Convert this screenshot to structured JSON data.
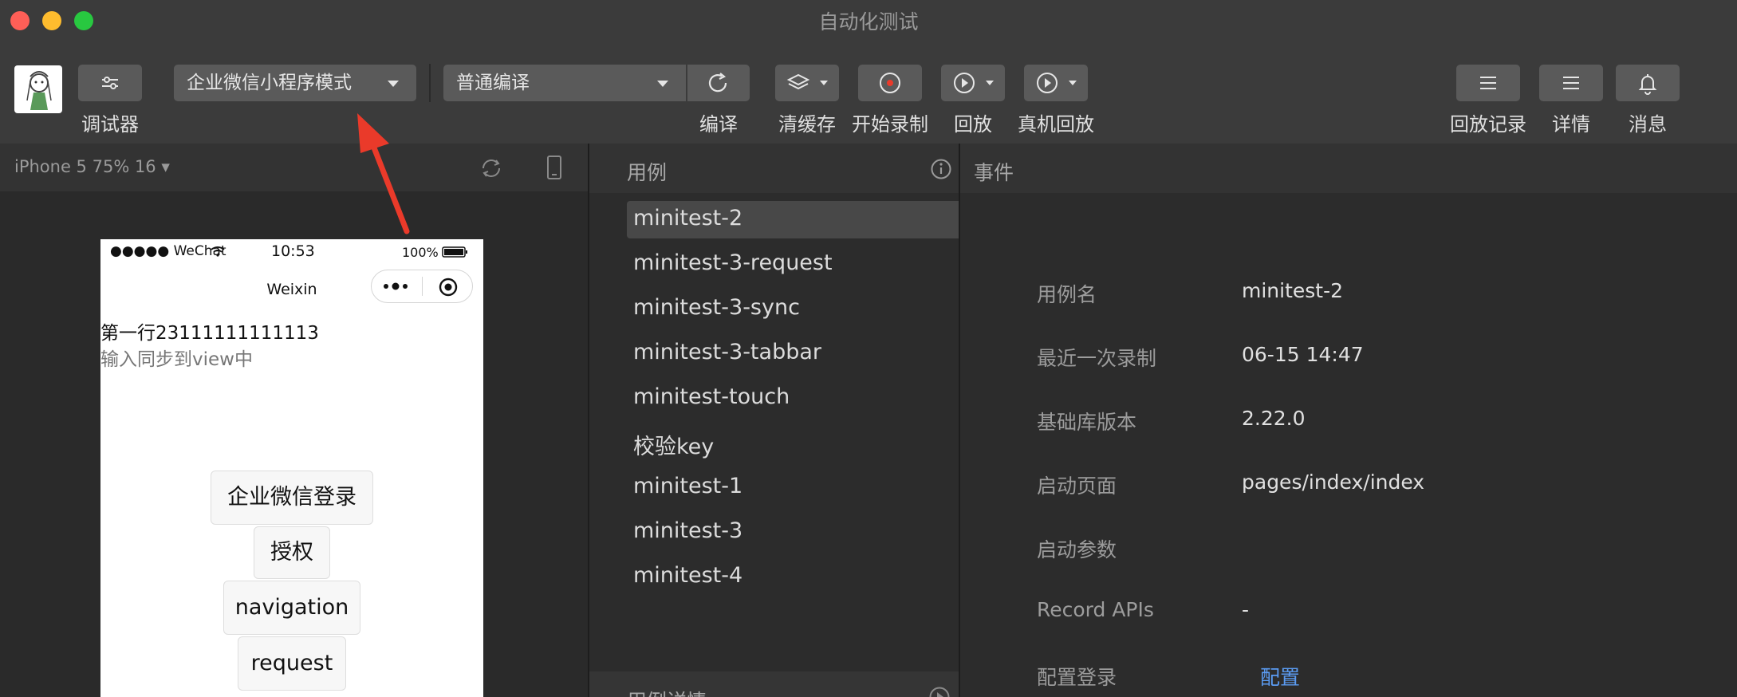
{
  "window": {
    "title": "自动化测试"
  },
  "colors": {
    "close": "#fe5f57",
    "minimize": "#febc2e",
    "maximize": "#28c840",
    "link": "#5b9cf3",
    "arrow": "#ea3a2a"
  },
  "toolbar": {
    "debugger_label": "调试器",
    "mode_select": "企业微信小程序模式",
    "compile_select": "普通编译",
    "compile_label": "编译",
    "clear_cache_label": "清缓存",
    "start_record_label": "开始录制",
    "replay_label": "回放",
    "device_replay_label": "真机回放",
    "replay_history_label": "回放记录",
    "details_label": "详情",
    "messages_label": "消息"
  },
  "simulator": {
    "device_select": "iPhone 5 75% 16 ▾",
    "status_carrier": "●●●●● WeChat",
    "status_time": "10:53",
    "status_battery": "100%",
    "nav_title": "Weixin",
    "line1": "第一行23111111111113",
    "line2": "输入同步到view中",
    "buttons": [
      "企业微信登录",
      "授权",
      "navigation",
      "request"
    ]
  },
  "cases": {
    "header": "用例",
    "items": [
      "minitest-2",
      "minitest-3-request",
      "minitest-3-sync",
      "minitest-3-tabbar",
      "minitest-touch",
      "校验key",
      "minitest-1",
      "minitest-3",
      "minitest-4"
    ],
    "selected_index": 0,
    "details_header": "用例详情"
  },
  "events": {
    "header": "事件",
    "rows": [
      {
        "key": "用例名",
        "value": "minitest-2"
      },
      {
        "key": "最近一次录制",
        "value": "06-15 14:47"
      },
      {
        "key": "基础库版本",
        "value": "2.22.0"
      },
      {
        "key": "启动页面",
        "value": "pages/index/index"
      },
      {
        "key": "启动参数",
        "value": ""
      },
      {
        "key": "Record APIs",
        "value": "-"
      },
      {
        "key": "配置登录",
        "value": "配置"
      }
    ]
  },
  "icons": [
    "avatar",
    "settings-sliders-icon",
    "refresh-icon",
    "layers-icon",
    "record-icon",
    "play-icon",
    "list-icon",
    "bell-icon",
    "rotate-icon",
    "phone-icon",
    "info-icon",
    "wifi-icon",
    "battery-icon",
    "more-dots-icon",
    "target-icon"
  ]
}
